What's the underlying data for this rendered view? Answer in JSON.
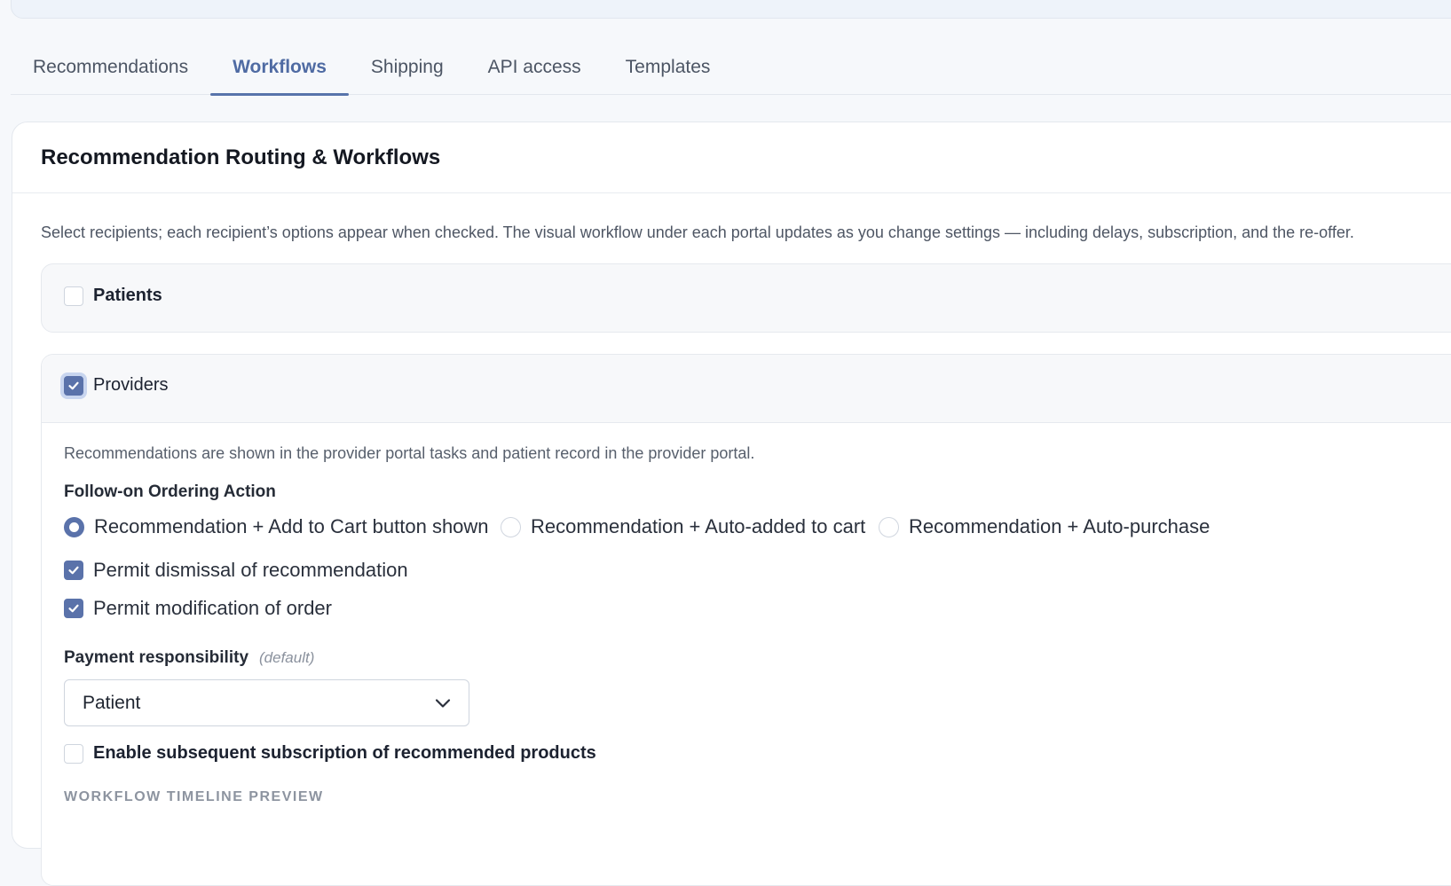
{
  "tabs": [
    {
      "label": "Recommendations",
      "active": false
    },
    {
      "label": "Workflows",
      "active": true
    },
    {
      "label": "Shipping",
      "active": false
    },
    {
      "label": "API access",
      "active": false
    },
    {
      "label": "Templates",
      "active": false
    }
  ],
  "card": {
    "title": "Recommendation Routing & Workflows",
    "description": "Select recipients; each recipient’s options appear when checked. The visual workflow under each portal updates as you change settings — including delays, subscription, and the re-offer."
  },
  "recipients": {
    "patients": {
      "label": "Patients",
      "checked": false
    },
    "providers": {
      "label": "Providers",
      "checked": true,
      "note": "Recommendations are shown in the provider portal tasks and patient record in the provider portal.",
      "ordering": {
        "heading": "Follow-on Ordering Action",
        "options": [
          {
            "label": "Recommendation + Add to Cart button shown",
            "selected": true
          },
          {
            "label": "Recommendation + Auto-added to cart",
            "selected": false
          },
          {
            "label": "Recommendation + Auto-purchase",
            "selected": false
          }
        ]
      },
      "permissions": [
        {
          "label": "Permit dismissal of recommendation",
          "checked": true
        },
        {
          "label": "Permit modification of order",
          "checked": true
        }
      ],
      "payment": {
        "heading": "Payment responsibility",
        "hint": "(default)",
        "selected": "Patient"
      },
      "subscription": {
        "label": "Enable subsequent subscription of recommended products",
        "checked": false
      },
      "timeline_label": "WORKFLOW TIMELINE PREVIEW"
    }
  },
  "colors": {
    "accent": "#5a72aa",
    "active_tab_text": "#4f6ba3",
    "page_bg": "#f6f8fb"
  }
}
